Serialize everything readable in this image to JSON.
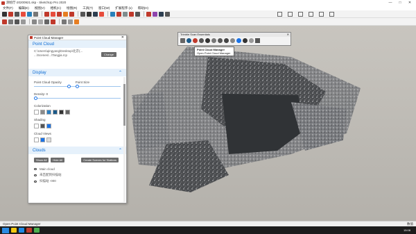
{
  "window": {
    "title": "测绘厅-20200921.skp - SketchUp Pro 2020",
    "controls": [
      "—",
      "□",
      "✕"
    ]
  },
  "menu": [
    "文件(F)",
    "编辑(E)",
    "视图(V)",
    "相机(C)",
    "绘图(R)",
    "工具(T)",
    "窗口(W)",
    "扩展程序 (x)",
    "帮助(H)"
  ],
  "panel": {
    "title": "Point Cloud Manager",
    "point_cloud_header": "Point Cloud",
    "path_line1": "C:\\Users\\qingyang\\Desktop\\北京(...",
    "path_line2": "...\\Scenes\\...\\Tangjia.rcp",
    "change_label": "Change",
    "display_header": "Display",
    "opacity_label": "Point Cloud Opacity",
    "size_label": "Point Size",
    "density_label": "Density: 0",
    "colorization_label": "Colorization",
    "shading_label": "Shading",
    "views_label": "Cloud Views",
    "clouds_header": "Clouds",
    "show_all": "Show All",
    "hide_all": "Hide All",
    "create_scenes": "Create Scenes for Stations",
    "cloud_items": [
      "Main cloud",
      "未匹配到扫描站",
      "扫描站 -000"
    ]
  },
  "float_toolbar": {
    "title": "Trimble Scan Essentials"
  },
  "tooltip": {
    "line1": "Point Cloud Manager",
    "line2": "Open Point Cloud Manager"
  },
  "status": {
    "text": "Open Point Cloud Manager",
    "measurements": "数值"
  },
  "taskbar": {
    "time": "15:08"
  }
}
